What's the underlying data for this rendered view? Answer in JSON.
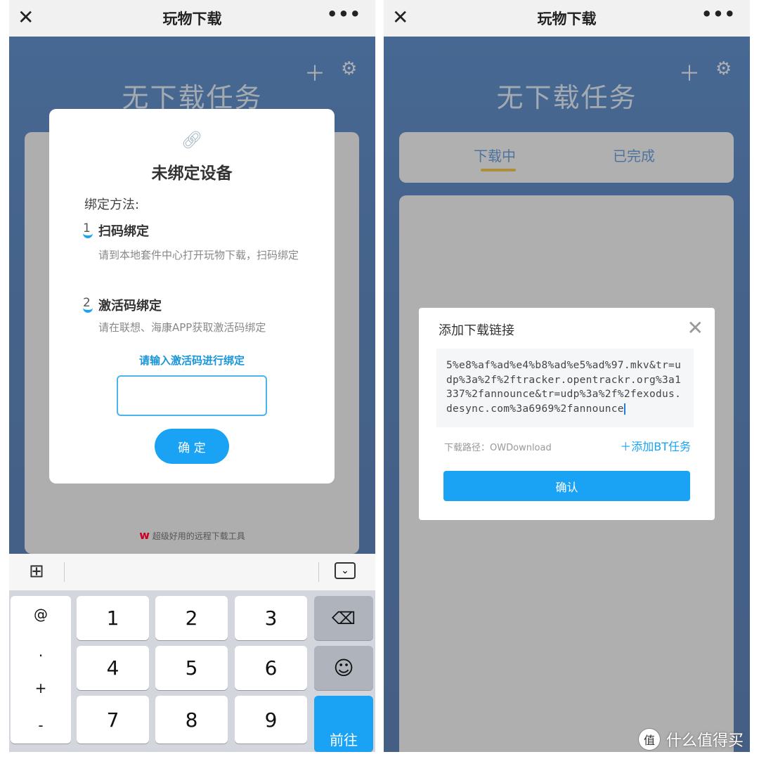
{
  "left": {
    "topbar": {
      "title": "玩物下载",
      "close_icon": "close-icon",
      "more_icon": "more-icon"
    },
    "header": {
      "title": "无下载任务",
      "add_icon": "plus-icon",
      "settings_icon": "gear-icon"
    },
    "footer_text": "超级好用的远程下载工具",
    "bind_dialog": {
      "link_icon": "link-icon",
      "title": "未绑定设备",
      "methods_label": "绑定方法:",
      "steps": [
        {
          "num": "1",
          "title": "扫码绑定",
          "desc": "请到本地套件中心打开玩物下载，扫码绑定"
        },
        {
          "num": "2",
          "title": "激活码绑定",
          "desc": "请在联想、海康APP获取激活码绑定"
        }
      ],
      "prompt": "请输入激活码进行绑定",
      "code_value": "",
      "confirm": "确 定"
    },
    "keyboard": {
      "side_keys": [
        "@",
        ".",
        "+",
        "-"
      ],
      "keys": [
        "1",
        "2",
        "3",
        "4",
        "5",
        "6",
        "7",
        "8",
        "9"
      ],
      "go": "前往",
      "grid_icon": "grid-icon",
      "collapse_icon": "keyboard-collapse-icon",
      "backspace_icon": "backspace-icon",
      "emoji_icon": "emoji-icon"
    }
  },
  "right": {
    "topbar": {
      "title": "玩物下载"
    },
    "header": {
      "title": "无下载任务"
    },
    "tabs": [
      "下载中",
      "已完成"
    ],
    "active_tab": 0,
    "add_dialog": {
      "title": "添加下载链接",
      "link_value": "5%e8%af%ad%e4%b8%ad%e5%ad%97.mkv&tr=udp%3a%2f%2ftracker.opentrackr.org%3a1337%2fannounce&tr=udp%3a%2f%2fexodus.desync.com%3a6969%2fannounce",
      "path_label": "下载路径：",
      "path_value": "OWDownload",
      "add_bt": "添加BT任务",
      "confirm": "确认"
    }
  },
  "watermark": "什么值得买",
  "colors": {
    "accent": "#1aa3f5",
    "tab_underline": "#d9a20a",
    "header_blue": "#1d5199"
  }
}
